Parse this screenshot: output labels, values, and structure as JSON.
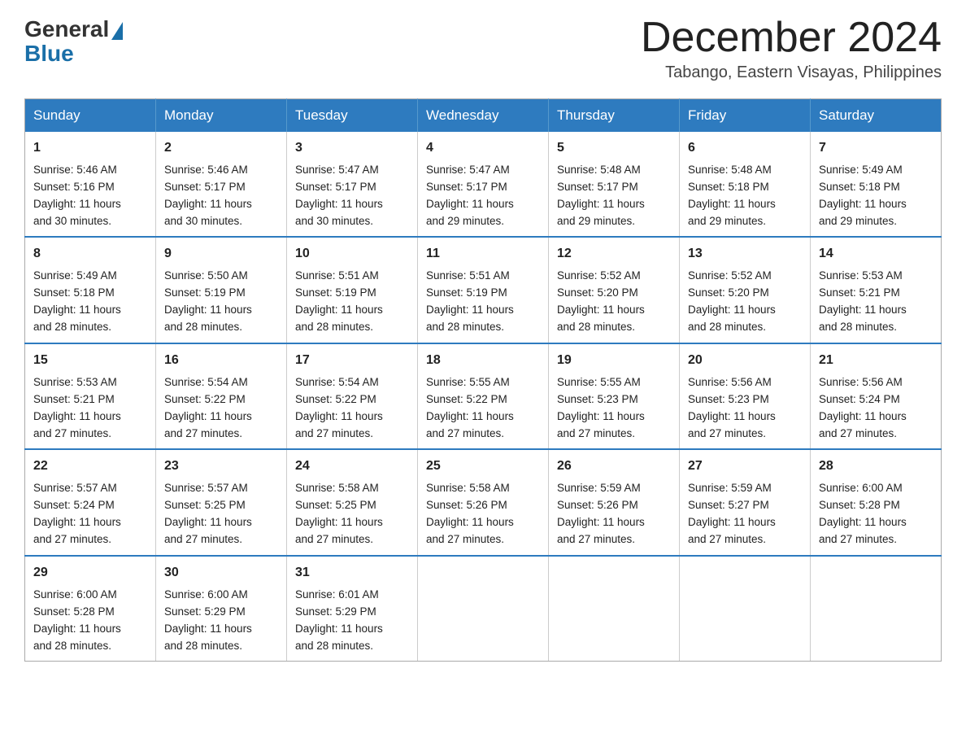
{
  "header": {
    "logo_general": "General",
    "logo_blue": "Blue",
    "month_title": "December 2024",
    "location": "Tabango, Eastern Visayas, Philippines"
  },
  "days_of_week": [
    "Sunday",
    "Monday",
    "Tuesday",
    "Wednesday",
    "Thursday",
    "Friday",
    "Saturday"
  ],
  "weeks": [
    [
      {
        "day": "1",
        "sunrise": "5:46 AM",
        "sunset": "5:16 PM",
        "daylight": "11 hours and 30 minutes."
      },
      {
        "day": "2",
        "sunrise": "5:46 AM",
        "sunset": "5:17 PM",
        "daylight": "11 hours and 30 minutes."
      },
      {
        "day": "3",
        "sunrise": "5:47 AM",
        "sunset": "5:17 PM",
        "daylight": "11 hours and 30 minutes."
      },
      {
        "day": "4",
        "sunrise": "5:47 AM",
        "sunset": "5:17 PM",
        "daylight": "11 hours and 29 minutes."
      },
      {
        "day": "5",
        "sunrise": "5:48 AM",
        "sunset": "5:17 PM",
        "daylight": "11 hours and 29 minutes."
      },
      {
        "day": "6",
        "sunrise": "5:48 AM",
        "sunset": "5:18 PM",
        "daylight": "11 hours and 29 minutes."
      },
      {
        "day": "7",
        "sunrise": "5:49 AM",
        "sunset": "5:18 PM",
        "daylight": "11 hours and 29 minutes."
      }
    ],
    [
      {
        "day": "8",
        "sunrise": "5:49 AM",
        "sunset": "5:18 PM",
        "daylight": "11 hours and 28 minutes."
      },
      {
        "day": "9",
        "sunrise": "5:50 AM",
        "sunset": "5:19 PM",
        "daylight": "11 hours and 28 minutes."
      },
      {
        "day": "10",
        "sunrise": "5:51 AM",
        "sunset": "5:19 PM",
        "daylight": "11 hours and 28 minutes."
      },
      {
        "day": "11",
        "sunrise": "5:51 AM",
        "sunset": "5:19 PM",
        "daylight": "11 hours and 28 minutes."
      },
      {
        "day": "12",
        "sunrise": "5:52 AM",
        "sunset": "5:20 PM",
        "daylight": "11 hours and 28 minutes."
      },
      {
        "day": "13",
        "sunrise": "5:52 AM",
        "sunset": "5:20 PM",
        "daylight": "11 hours and 28 minutes."
      },
      {
        "day": "14",
        "sunrise": "5:53 AM",
        "sunset": "5:21 PM",
        "daylight": "11 hours and 28 minutes."
      }
    ],
    [
      {
        "day": "15",
        "sunrise": "5:53 AM",
        "sunset": "5:21 PM",
        "daylight": "11 hours and 27 minutes."
      },
      {
        "day": "16",
        "sunrise": "5:54 AM",
        "sunset": "5:22 PM",
        "daylight": "11 hours and 27 minutes."
      },
      {
        "day": "17",
        "sunrise": "5:54 AM",
        "sunset": "5:22 PM",
        "daylight": "11 hours and 27 minutes."
      },
      {
        "day": "18",
        "sunrise": "5:55 AM",
        "sunset": "5:22 PM",
        "daylight": "11 hours and 27 minutes."
      },
      {
        "day": "19",
        "sunrise": "5:55 AM",
        "sunset": "5:23 PM",
        "daylight": "11 hours and 27 minutes."
      },
      {
        "day": "20",
        "sunrise": "5:56 AM",
        "sunset": "5:23 PM",
        "daylight": "11 hours and 27 minutes."
      },
      {
        "day": "21",
        "sunrise": "5:56 AM",
        "sunset": "5:24 PM",
        "daylight": "11 hours and 27 minutes."
      }
    ],
    [
      {
        "day": "22",
        "sunrise": "5:57 AM",
        "sunset": "5:24 PM",
        "daylight": "11 hours and 27 minutes."
      },
      {
        "day": "23",
        "sunrise": "5:57 AM",
        "sunset": "5:25 PM",
        "daylight": "11 hours and 27 minutes."
      },
      {
        "day": "24",
        "sunrise": "5:58 AM",
        "sunset": "5:25 PM",
        "daylight": "11 hours and 27 minutes."
      },
      {
        "day": "25",
        "sunrise": "5:58 AM",
        "sunset": "5:26 PM",
        "daylight": "11 hours and 27 minutes."
      },
      {
        "day": "26",
        "sunrise": "5:59 AM",
        "sunset": "5:26 PM",
        "daylight": "11 hours and 27 minutes."
      },
      {
        "day": "27",
        "sunrise": "5:59 AM",
        "sunset": "5:27 PM",
        "daylight": "11 hours and 27 minutes."
      },
      {
        "day": "28",
        "sunrise": "6:00 AM",
        "sunset": "5:28 PM",
        "daylight": "11 hours and 27 minutes."
      }
    ],
    [
      {
        "day": "29",
        "sunrise": "6:00 AM",
        "sunset": "5:28 PM",
        "daylight": "11 hours and 28 minutes."
      },
      {
        "day": "30",
        "sunrise": "6:00 AM",
        "sunset": "5:29 PM",
        "daylight": "11 hours and 28 minutes."
      },
      {
        "day": "31",
        "sunrise": "6:01 AM",
        "sunset": "5:29 PM",
        "daylight": "11 hours and 28 minutes."
      },
      null,
      null,
      null,
      null
    ]
  ],
  "labels": {
    "sunrise": "Sunrise:",
    "sunset": "Sunset:",
    "daylight": "Daylight:"
  }
}
